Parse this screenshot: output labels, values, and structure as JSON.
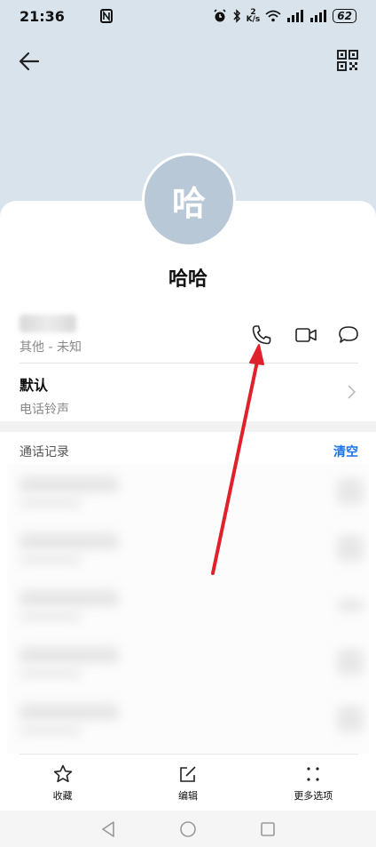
{
  "status": {
    "time": "21:36",
    "speed_top": "2",
    "speed_unit": "K/s",
    "battery": "62"
  },
  "contact": {
    "avatar_char": "哈",
    "name": "哈哈",
    "phone_type": "其他 - 未知"
  },
  "ringtone": {
    "title": "默认",
    "subtitle": "电话铃声"
  },
  "calls": {
    "title": "通话记录",
    "clear": "清空"
  },
  "bottom_tabs": {
    "favorite": "收藏",
    "edit": "编辑",
    "more": "更多选项"
  },
  "colors": {
    "header_bg": "#d9e3ec",
    "avatar_bg": "#b9c8d6",
    "accent_blue": "#1a73e8",
    "arrow_red": "#e0202a"
  }
}
